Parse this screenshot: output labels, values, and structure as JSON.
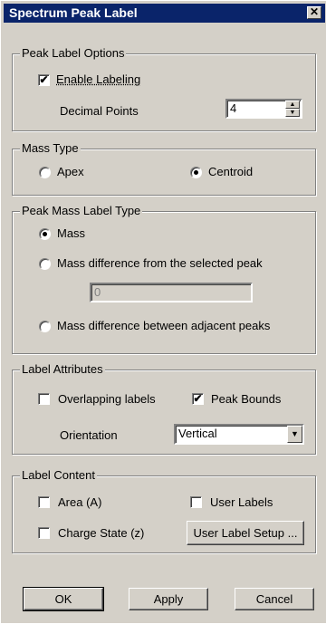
{
  "dialog": {
    "title": "Spectrum Peak Label",
    "close_glyph": "✕"
  },
  "peak_label_options": {
    "title": "Peak Label Options",
    "enable_labeling": {
      "label": "Enable Labeling",
      "checked": true
    },
    "decimal_points": {
      "label": "Decimal Points",
      "value": "4"
    }
  },
  "mass_type": {
    "title": "Mass Type",
    "apex": {
      "label": "Apex",
      "selected": false
    },
    "centroid": {
      "label": "Centroid",
      "selected": true
    }
  },
  "peak_mass_label_type": {
    "title": "Peak Mass Label Type",
    "mass": {
      "label": "Mass",
      "selected": true
    },
    "diff_selected": {
      "label": "Mass difference from the selected peak",
      "selected": false
    },
    "diff_value": "0",
    "diff_adjacent": {
      "label": "Mass difference between adjacent peaks",
      "selected": false
    }
  },
  "label_attributes": {
    "title": "Label Attributes",
    "overlapping": {
      "label": "Overlapping labels",
      "checked": false
    },
    "peak_bounds": {
      "label": "Peak Bounds",
      "checked": true
    },
    "orientation": {
      "label": "Orientation",
      "value": "Vertical"
    }
  },
  "label_content": {
    "title": "Label Content",
    "area": {
      "label": "Area (A)",
      "checked": false
    },
    "user_labels": {
      "label": "User Labels",
      "checked": false
    },
    "charge_state": {
      "label": "Charge State (z)",
      "checked": false
    },
    "user_label_setup": "User Label Setup ..."
  },
  "buttons": {
    "ok": "OK",
    "apply": "Apply",
    "cancel": "Cancel"
  },
  "glyphs": {
    "check": "✔",
    "spin_up": "▲",
    "spin_down": "▼",
    "dropdown": "▼"
  }
}
